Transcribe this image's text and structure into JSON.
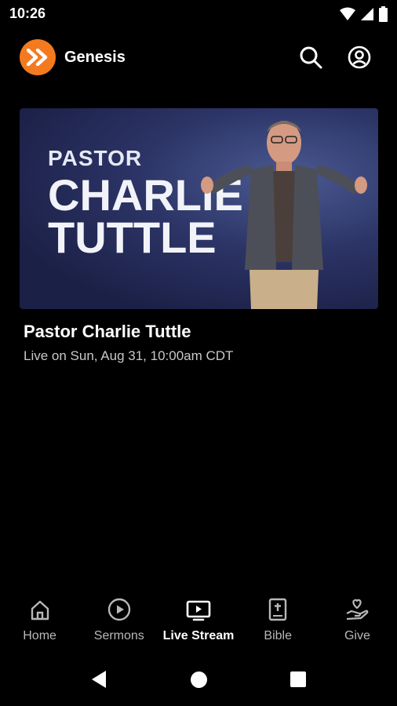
{
  "status_bar": {
    "time": "10:26",
    "icons": [
      "wifi-icon",
      "cellular-icon",
      "battery-icon"
    ]
  },
  "app_bar": {
    "logo_icon": "double-chevron-logo",
    "title": "Genesis",
    "actions": [
      "search-icon",
      "account-icon"
    ]
  },
  "stream": {
    "thumbnail_text": {
      "line1": "PASTOR",
      "line2": "CHARLIE",
      "line3": "TUTTLE"
    },
    "title": "Pastor Charlie Tuttle",
    "subtitle": "Live on Sun, Aug 31, 10:00am CDT"
  },
  "bottom_nav": {
    "items": [
      {
        "label": "Home",
        "icon": "home-icon"
      },
      {
        "label": "Sermons",
        "icon": "play-circle-icon"
      },
      {
        "label": "Live Stream",
        "icon": "tv-play-icon",
        "active": true
      },
      {
        "label": "Bible",
        "icon": "bible-icon"
      },
      {
        "label": "Give",
        "icon": "hand-heart-icon"
      }
    ]
  },
  "colors": {
    "background": "#000000",
    "accent": "#f47a20",
    "inactive_label": "#b8b8b8"
  }
}
